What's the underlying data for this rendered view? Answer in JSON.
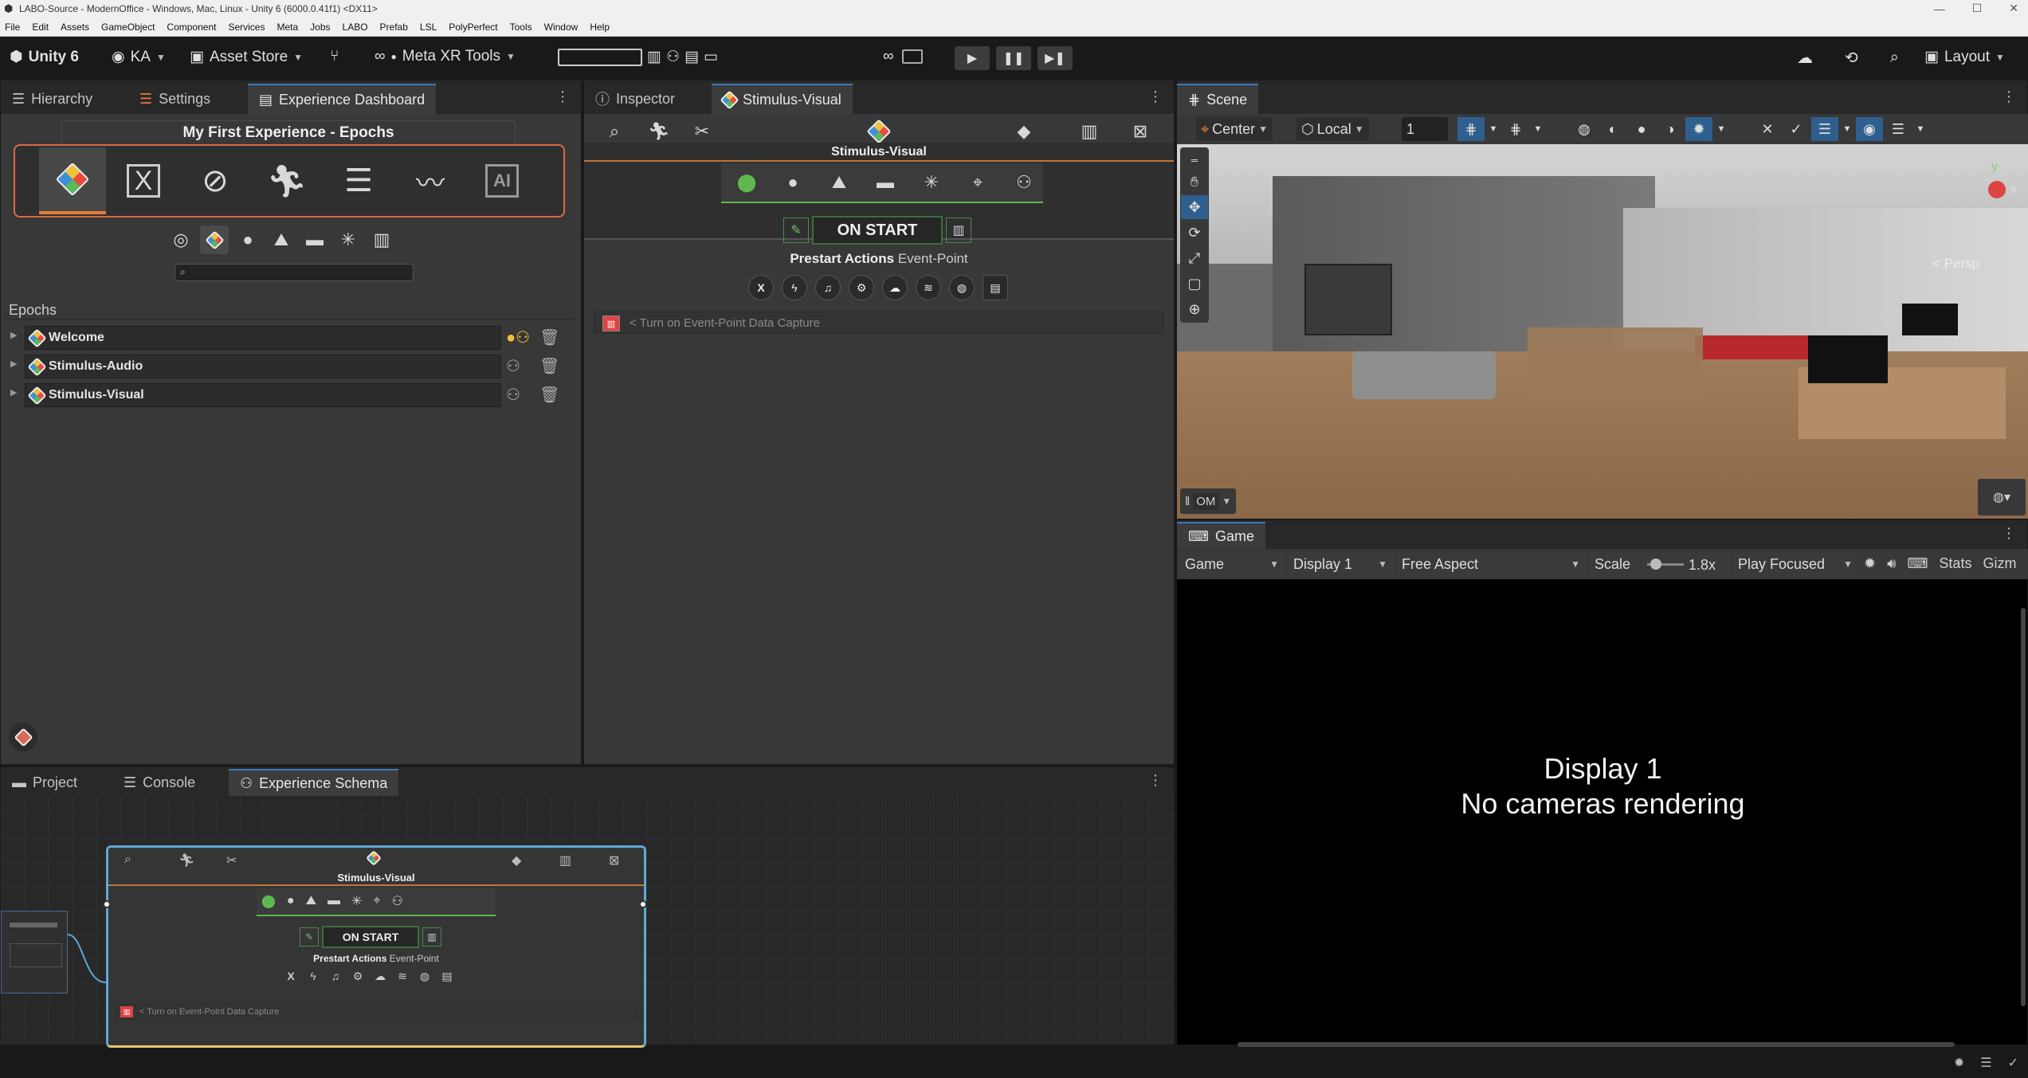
{
  "titlebar": {
    "title": "LABO-Source - ModernOffice - Windows, Mac, Linux - Unity 6 (6000.0.41f1) <DX11>"
  },
  "menu": [
    "File",
    "Edit",
    "Assets",
    "GameObject",
    "Component",
    "Services",
    "Meta",
    "Jobs",
    "LABO",
    "Prefab",
    "LSL",
    "PolyPerfect",
    "Tools",
    "Window",
    "Help"
  ],
  "toolbar": {
    "unity": "Unity 6",
    "account": "KA",
    "asset_store": "Asset Store",
    "meta_xr": "Meta XR Tools",
    "layout": "Layout"
  },
  "left_panel": {
    "tabs": [
      "Hierarchy",
      "Settings",
      "Experience Dashboard"
    ],
    "experience_title": "My First Experience - Epochs",
    "epochs_header": "Epochs",
    "epochs": [
      {
        "name": "Welcome"
      },
      {
        "name": "Stimulus-Audio"
      },
      {
        "name": "Stimulus-Visual"
      }
    ]
  },
  "inspector": {
    "tabs": [
      "Inspector",
      "Stimulus-Visual"
    ],
    "component_title": "Stimulus-Visual",
    "on_start": "ON START",
    "prestart_actions": "Prestart Actions",
    "event_point": "Event-Point",
    "capture_text": "< Turn on Event-Point Data Capture"
  },
  "scene": {
    "tab": "Scene",
    "pivot": "Center",
    "space": "Local",
    "grid_value": "1",
    "persp": "< Persp",
    "overlay_menu": "OM",
    "axis_y": "y",
    "axis_x": "x"
  },
  "game": {
    "tab": "Game",
    "mode": "Game",
    "display": "Display 1",
    "aspect": "Free Aspect",
    "scale_label": "Scale",
    "scale_value": "1.8x",
    "play_focused": "Play Focused",
    "stats": "Stats",
    "gizmos": "Gizm",
    "message_line1": "Display 1",
    "message_line2": "No cameras rendering"
  },
  "bottom_panel": {
    "tabs": [
      "Project",
      "Console",
      "Experience Schema"
    ],
    "node_title": "Stimulus-Visual",
    "on_start": "ON START",
    "prestart_actions": "Prestart Actions",
    "event_point": "Event-Point",
    "capture_text": "< Turn on Event-Point Data Capture"
  },
  "colors": {
    "accent": "#3a79bb",
    "green": "#5fb84f",
    "node_border": "#5fa8d8",
    "node_border_bottom": "#e8c46a"
  }
}
